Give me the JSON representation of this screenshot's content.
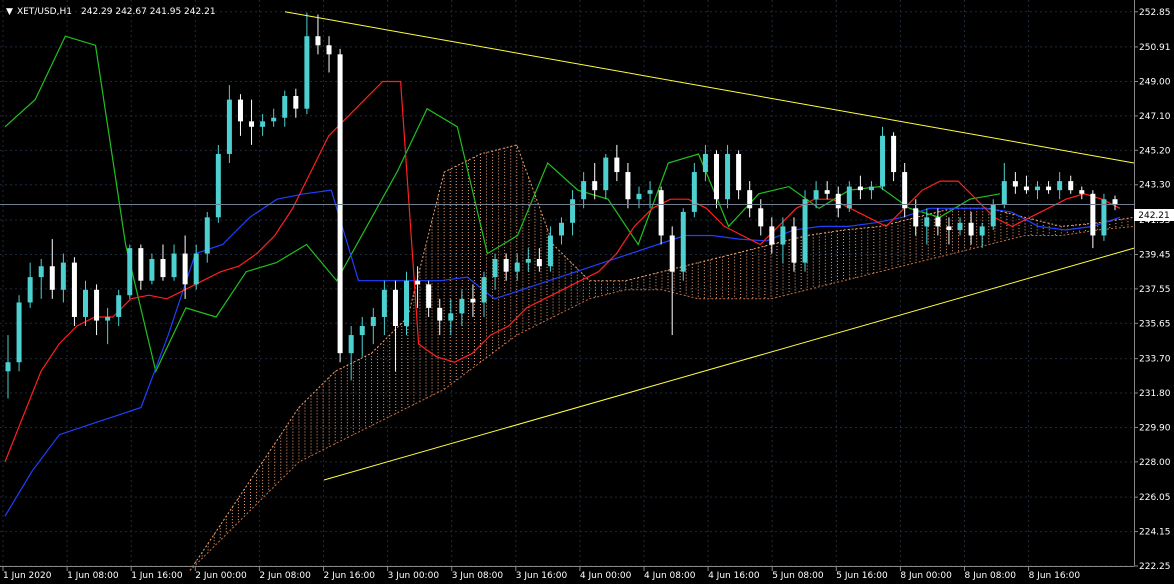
{
  "header": {
    "symbol": "XET/USD,H1",
    "ohlc": "242.29 242.67 241.95 242.21",
    "triangle_glyph": "▼"
  },
  "current_price": "242.21",
  "colors": {
    "background": "#000000",
    "grid": "#1e2a3a",
    "bull": "#4dd0d0",
    "bear": "#ffffff",
    "tenkan": "#ff2020",
    "kijun": "#2040ff",
    "chikou": "#20c020",
    "cloud_a": "#f0a070",
    "cloud_b": "#c87040",
    "trendline": "#ffff40",
    "price_line": "#708090",
    "axis_text": "#ffffff"
  },
  "chart_data": {
    "type": "candlestick",
    "indicator": "Ichimoku",
    "ylim": [
      222.25,
      253.5
    ],
    "y_ticks": [
      "252.85",
      "250.91",
      "249.00",
      "247.10",
      "245.20",
      "243.30",
      "241.35",
      "239.45",
      "237.55",
      "235.65",
      "233.70",
      "231.80",
      "229.90",
      "228.00",
      "226.05",
      "224.15",
      "222.25"
    ],
    "x_ticks": [
      "1 Jun 2020",
      "1 Jun 08:00",
      "1 Jun 16:00",
      "2 Jun 00:00",
      "2 Jun 08:00",
      "2 Jun 16:00",
      "3 Jun 00:00",
      "3 Jun 08:00",
      "3 Jun 16:00",
      "4 Jun 00:00",
      "4 Jun 08:00",
      "4 Jun 16:00",
      "5 Jun 08:00",
      "5 Jun 16:00",
      "8 Jun 00:00",
      "8 Jun 08:00",
      "8 Jun 16:00"
    ],
    "candles": [
      [
        233.0,
        235.0,
        231.5,
        233.5
      ],
      [
        233.5,
        237.2,
        233.0,
        236.8
      ],
      [
        236.8,
        239.0,
        236.5,
        238.2
      ],
      [
        238.2,
        239.2,
        237.0,
        238.8
      ],
      [
        238.8,
        240.3,
        237.0,
        237.5
      ],
      [
        237.5,
        239.5,
        236.8,
        239.0
      ],
      [
        239.0,
        239.3,
        235.5,
        236.0
      ],
      [
        236.0,
        238.0,
        235.5,
        237.5
      ],
      [
        237.5,
        237.8,
        235.0,
        235.8
      ],
      [
        235.8,
        236.5,
        234.5,
        236.0
      ],
      [
        236.0,
        237.5,
        235.5,
        237.2
      ],
      [
        237.2,
        240.0,
        237.0,
        239.8
      ],
      [
        239.8,
        240.0,
        237.5,
        238.0
      ],
      [
        238.0,
        239.5,
        237.8,
        239.2
      ],
      [
        239.2,
        240.0,
        238.0,
        238.2
      ],
      [
        238.2,
        240.0,
        238.0,
        239.5
      ],
      [
        239.5,
        240.5,
        237.0,
        237.8
      ],
      [
        237.8,
        240.0,
        237.5,
        239.5
      ],
      [
        239.5,
        241.8,
        239.0,
        241.5
      ],
      [
        241.5,
        245.5,
        241.2,
        245.0
      ],
      [
        245.0,
        248.8,
        244.5,
        248.0
      ],
      [
        248.0,
        248.3,
        246.0,
        246.8
      ],
      [
        246.8,
        248.0,
        245.5,
        246.5
      ],
      [
        246.5,
        247.2,
        246.0,
        246.8
      ],
      [
        246.8,
        247.5,
        246.5,
        247.0
      ],
      [
        247.0,
        248.5,
        246.5,
        248.2
      ],
      [
        248.2,
        248.6,
        247.0,
        247.5
      ],
      [
        247.5,
        252.8,
        247.2,
        251.5
      ],
      [
        251.5,
        252.7,
        250.5,
        251.0
      ],
      [
        251.0,
        251.5,
        249.5,
        250.5
      ],
      [
        250.5,
        250.8,
        233.5,
        234.0
      ],
      [
        234.0,
        235.5,
        232.5,
        235.0
      ],
      [
        235.0,
        236.0,
        233.8,
        235.5
      ],
      [
        235.5,
        236.5,
        234.5,
        236.0
      ],
      [
        236.0,
        238.0,
        235.0,
        237.5
      ],
      [
        237.5,
        238.0,
        233.0,
        235.5
      ],
      [
        235.5,
        238.5,
        235.0,
        238.0
      ],
      [
        238.0,
        238.8,
        236.5,
        237.8
      ],
      [
        237.8,
        238.0,
        236.0,
        236.5
      ],
      [
        236.5,
        237.0,
        235.0,
        235.8
      ],
      [
        235.8,
        237.0,
        235.0,
        236.2
      ],
      [
        236.2,
        237.5,
        235.5,
        237.0
      ],
      [
        237.0,
        237.8,
        236.0,
        236.8
      ],
      [
        236.8,
        238.5,
        236.0,
        238.2
      ],
      [
        238.2,
        239.5,
        237.5,
        239.2
      ],
      [
        239.2,
        239.5,
        238.0,
        238.5
      ],
      [
        238.5,
        239.5,
        238.0,
        239.0
      ],
      [
        239.0,
        239.8,
        238.5,
        239.2
      ],
      [
        239.2,
        239.8,
        238.5,
        238.8
      ],
      [
        238.8,
        241.0,
        238.5,
        240.5
      ],
      [
        240.5,
        241.5,
        240.0,
        241.2
      ],
      [
        241.2,
        243.0,
        240.5,
        242.5
      ],
      [
        242.5,
        244.0,
        242.0,
        243.5
      ],
      [
        243.5,
        244.5,
        242.5,
        243.0
      ],
      [
        243.0,
        245.0,
        242.5,
        244.8
      ],
      [
        244.8,
        245.5,
        243.5,
        244.0
      ],
      [
        244.0,
        244.5,
        242.0,
        242.5
      ],
      [
        242.5,
        243.2,
        242.0,
        242.8
      ],
      [
        242.8,
        243.5,
        242.0,
        243.0
      ],
      [
        243.0,
        243.2,
        240.0,
        240.5
      ],
      [
        240.5,
        241.0,
        235.0,
        238.5
      ],
      [
        238.5,
        242.0,
        238.0,
        241.8
      ],
      [
        241.8,
        244.5,
        241.5,
        244.0
      ],
      [
        244.0,
        245.5,
        243.5,
        245.0
      ],
      [
        245.0,
        245.2,
        242.0,
        242.5
      ],
      [
        242.5,
        245.5,
        242.0,
        245.0
      ],
      [
        245.0,
        245.2,
        242.5,
        243.0
      ],
      [
        243.0,
        243.5,
        241.5,
        242.0
      ],
      [
        242.0,
        242.5,
        240.5,
        241.0
      ],
      [
        241.0,
        241.5,
        239.5,
        240.0
      ],
      [
        240.0,
        241.5,
        239.0,
        241.0
      ],
      [
        241.0,
        241.5,
        238.5,
        239.0
      ],
      [
        239.0,
        243.0,
        238.5,
        242.5
      ],
      [
        242.5,
        243.5,
        242.0,
        243.0
      ],
      [
        243.0,
        243.5,
        242.5,
        242.8
      ],
      [
        242.8,
        243.2,
        241.5,
        242.0
      ],
      [
        242.0,
        243.5,
        241.8,
        243.2
      ],
      [
        243.2,
        243.8,
        242.5,
        243.0
      ],
      [
        243.0,
        243.5,
        242.5,
        243.2
      ],
      [
        243.2,
        246.5,
        243.0,
        246.0
      ],
      [
        246.0,
        246.2,
        243.5,
        244.0
      ],
      [
        244.0,
        244.5,
        241.5,
        242.0
      ],
      [
        242.0,
        242.5,
        240.5,
        241.0
      ],
      [
        241.0,
        242.0,
        240.0,
        241.5
      ],
      [
        241.5,
        242.0,
        240.5,
        241.0
      ],
      [
        241.0,
        241.5,
        240.0,
        240.8
      ],
      [
        240.8,
        241.5,
        240.5,
        241.2
      ],
      [
        241.2,
        241.8,
        240.0,
        240.5
      ],
      [
        240.5,
        241.2,
        239.8,
        241.0
      ],
      [
        241.0,
        242.5,
        240.8,
        242.2
      ],
      [
        242.2,
        244.5,
        242.0,
        243.5
      ],
      [
        243.5,
        244.0,
        242.8,
        243.2
      ],
      [
        243.2,
        243.8,
        242.8,
        243.0
      ],
      [
        243.0,
        243.5,
        242.5,
        243.2
      ],
      [
        243.2,
        243.5,
        242.8,
        243.0
      ],
      [
        243.0,
        244.0,
        242.5,
        243.5
      ],
      [
        243.5,
        243.8,
        242.8,
        243.0
      ],
      [
        243.0,
        243.2,
        242.5,
        242.8
      ],
      [
        242.8,
        243.0,
        239.8,
        240.5
      ],
      [
        240.5,
        242.8,
        240.2,
        242.5
      ],
      [
        242.5,
        242.7,
        241.9,
        242.2
      ]
    ],
    "tenkan": [
      228.0,
      230.5,
      233.0,
      234.5,
      235.5,
      236.0,
      236.0,
      237.0,
      237.2,
      237.0,
      237.5,
      238.0,
      238.5,
      238.8,
      239.5,
      240.5,
      242.0,
      244.0,
      246.0,
      247.0,
      248.0,
      249.0,
      249.0,
      234.5,
      233.8,
      233.5,
      234.0,
      235.0,
      235.5,
      236.5,
      237.0,
      237.5,
      238.0,
      238.5,
      239.5,
      241.0,
      242.0,
      242.5,
      242.5,
      242.0,
      241.0,
      240.5,
      240.0,
      241.0,
      242.0,
      242.5,
      242.5,
      242.0,
      241.5,
      241.0,
      242.0,
      243.0,
      243.5,
      243.5,
      242.5,
      241.5,
      241.0,
      241.5,
      242.0,
      242.5,
      242.8,
      242.5,
      242.0
    ],
    "kijun": [
      225.0,
      227.5,
      229.5,
      230.0,
      230.5,
      231.0,
      235.0,
      239.5,
      240.0,
      241.5,
      242.5,
      242.8,
      243.0,
      238.0,
      238.0,
      238.0,
      238.0,
      238.2,
      237.0,
      237.5,
      238.0,
      238.5,
      239.0,
      239.5,
      240.0,
      240.5,
      240.5,
      240.3,
      240.2,
      240.8,
      241.0,
      241.0,
      241.2,
      241.5,
      242.0,
      242.0,
      242.0,
      241.8,
      241.0,
      240.8,
      241.0,
      241.5
    ],
    "chikou": [
      246.5,
      248.0,
      251.5,
      251.0,
      240.0,
      233.0,
      236.5,
      236.0,
      238.5,
      239.0,
      240.0,
      238.0,
      241.0,
      244.0,
      247.5,
      246.5,
      239.5,
      240.5,
      244.5,
      243.0,
      242.5,
      240.0,
      244.5,
      245.0,
      241.0,
      242.8,
      243.2,
      242.0,
      243.0,
      243.2,
      242.0,
      241.5,
      242.5,
      242.8
    ],
    "span_a": [
      222.0,
      225.0,
      228.0,
      231.0,
      233.0,
      234.0,
      236.0,
      244.0,
      245.0,
      245.5,
      240.0,
      238.0,
      238.0,
      238.5,
      239.0,
      239.5,
      240.0,
      240.5,
      240.8,
      241.0,
      241.5,
      242.0,
      242.0,
      241.5,
      241.0,
      241.2,
      241.5
    ],
    "span_b": [
      222.0,
      224.0,
      226.0,
      228.0,
      229.0,
      230.0,
      231.0,
      232.0,
      233.5,
      235.0,
      236.0,
      237.0,
      237.5,
      237.5,
      237.0,
      237.0,
      237.0,
      237.5,
      238.0,
      238.5,
      239.0,
      239.5,
      240.0,
      240.5,
      240.5,
      240.8,
      241.0
    ],
    "trendlines": [
      {
        "from": {
          "x": "2 Jun 08:00",
          "y": 252.85
        },
        "to": {
          "x": "8 Jun 20:00",
          "y": 244.5
        }
      },
      {
        "from": {
          "x": "2 Jun 16:00",
          "y": 227.0
        },
        "to": {
          "x": "8 Jun 20:00",
          "y": 239.8
        }
      }
    ],
    "last_price": 242.21
  }
}
